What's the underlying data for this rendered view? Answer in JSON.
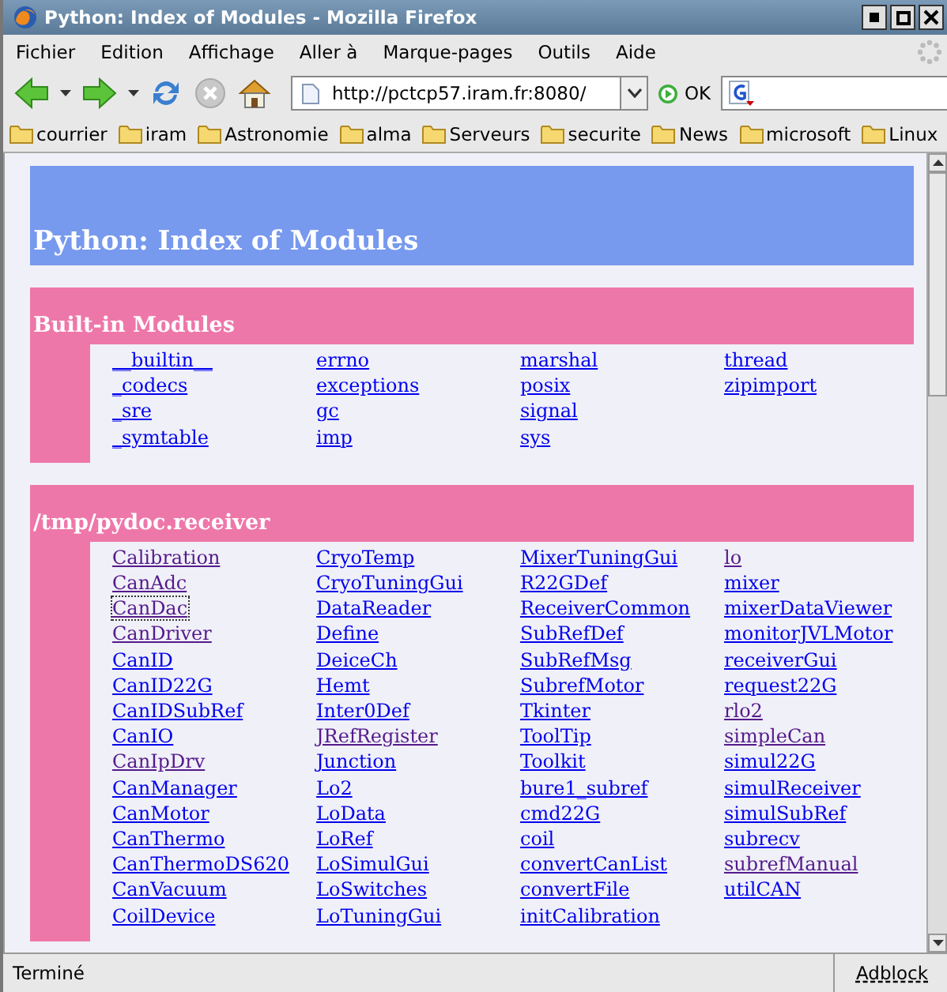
{
  "window": {
    "title": "Python: Index of Modules - Mozilla Firefox"
  },
  "menu": [
    "Fichier",
    "Edition",
    "Affichage",
    "Aller à",
    "Marque-pages",
    "Outils",
    "Aide"
  ],
  "address": {
    "value": "http://pctcp57.iram.fr:8080/"
  },
  "go_button": "OK",
  "bookmarks": [
    "courrier",
    "iram",
    "Astronomie",
    "alma",
    "Serveurs",
    "securite",
    "News",
    "microsoft",
    "Linux"
  ],
  "page_title": "Python: Index of Modules",
  "sections": [
    {
      "heading": "Built-in Modules",
      "columns": [
        [
          {
            "name": "__builtin__",
            "visited": false
          },
          {
            "name": "_codecs",
            "visited": false
          },
          {
            "name": "_sre",
            "visited": false
          },
          {
            "name": "_symtable",
            "visited": false
          }
        ],
        [
          {
            "name": "errno",
            "visited": false
          },
          {
            "name": "exceptions",
            "visited": false
          },
          {
            "name": "gc",
            "visited": false
          },
          {
            "name": "imp",
            "visited": false
          }
        ],
        [
          {
            "name": "marshal",
            "visited": false
          },
          {
            "name": "posix",
            "visited": false
          },
          {
            "name": "signal",
            "visited": false
          },
          {
            "name": "sys",
            "visited": false
          }
        ],
        [
          {
            "name": "thread",
            "visited": false
          },
          {
            "name": "zipimport",
            "visited": false
          }
        ]
      ]
    },
    {
      "heading": "/tmp/pydoc.receiver",
      "columns": [
        [
          {
            "name": "Calibration",
            "visited": true
          },
          {
            "name": "CanAdc",
            "visited": true
          },
          {
            "name": "CanDac",
            "visited": true,
            "focused": true
          },
          {
            "name": "CanDriver",
            "visited": true
          },
          {
            "name": "CanID",
            "visited": false
          },
          {
            "name": "CanID22G",
            "visited": false
          },
          {
            "name": "CanIDSubRef",
            "visited": false
          },
          {
            "name": "CanIO",
            "visited": false
          },
          {
            "name": "CanIpDrv",
            "visited": true
          },
          {
            "name": "CanManager",
            "visited": false
          },
          {
            "name": "CanMotor",
            "visited": false
          },
          {
            "name": "CanThermo",
            "visited": false
          },
          {
            "name": "CanThermoDS620",
            "visited": false
          },
          {
            "name": "CanVacuum",
            "visited": false
          },
          {
            "name": "CoilDevice",
            "visited": false
          }
        ],
        [
          {
            "name": "CryoTemp",
            "visited": false
          },
          {
            "name": "CryoTuningGui",
            "visited": false
          },
          {
            "name": "DataReader",
            "visited": false
          },
          {
            "name": "Define",
            "visited": false
          },
          {
            "name": "DeiceCh",
            "visited": false
          },
          {
            "name": "Hemt",
            "visited": false
          },
          {
            "name": "Inter0Def",
            "visited": false
          },
          {
            "name": "JRefRegister",
            "visited": true
          },
          {
            "name": "Junction",
            "visited": false
          },
          {
            "name": "Lo2",
            "visited": false
          },
          {
            "name": "LoData",
            "visited": false
          },
          {
            "name": "LoRef",
            "visited": false
          },
          {
            "name": "LoSimulGui",
            "visited": false
          },
          {
            "name": "LoSwitches",
            "visited": false
          },
          {
            "name": "LoTuningGui",
            "visited": false
          }
        ],
        [
          {
            "name": "MixerTuningGui",
            "visited": false
          },
          {
            "name": "R22GDef",
            "visited": false
          },
          {
            "name": "ReceiverCommon",
            "visited": false
          },
          {
            "name": "SubRefDef",
            "visited": false
          },
          {
            "name": "SubRefMsg",
            "visited": false
          },
          {
            "name": "SubrefMotor",
            "visited": false
          },
          {
            "name": "Tkinter",
            "visited": false
          },
          {
            "name": "ToolTip",
            "visited": false
          },
          {
            "name": "Toolkit",
            "visited": false
          },
          {
            "name": "bure1_subref",
            "visited": false
          },
          {
            "name": "cmd22G",
            "visited": false
          },
          {
            "name": "coil",
            "visited": false
          },
          {
            "name": "convertCanList",
            "visited": false
          },
          {
            "name": "convertFile",
            "visited": false
          },
          {
            "name": "initCalibration",
            "visited": false
          }
        ],
        [
          {
            "name": "lo",
            "visited": true
          },
          {
            "name": "mixer",
            "visited": false
          },
          {
            "name": "mixerDataViewer",
            "visited": false
          },
          {
            "name": "monitorJVLMotor",
            "visited": false
          },
          {
            "name": "receiverGui",
            "visited": false
          },
          {
            "name": "request22G",
            "visited": false
          },
          {
            "name": "rlo2",
            "visited": true
          },
          {
            "name": "simpleCan",
            "visited": true
          },
          {
            "name": "simul22G",
            "visited": false
          },
          {
            "name": "simulReceiver",
            "visited": false
          },
          {
            "name": "simulSubRef",
            "visited": false
          },
          {
            "name": "subrecv",
            "visited": false
          },
          {
            "name": "subrefManual",
            "visited": true
          },
          {
            "name": "utilCAN",
            "visited": false
          }
        ]
      ]
    }
  ],
  "status_bar": {
    "text": "Terminé",
    "adblock": "Adblock"
  }
}
